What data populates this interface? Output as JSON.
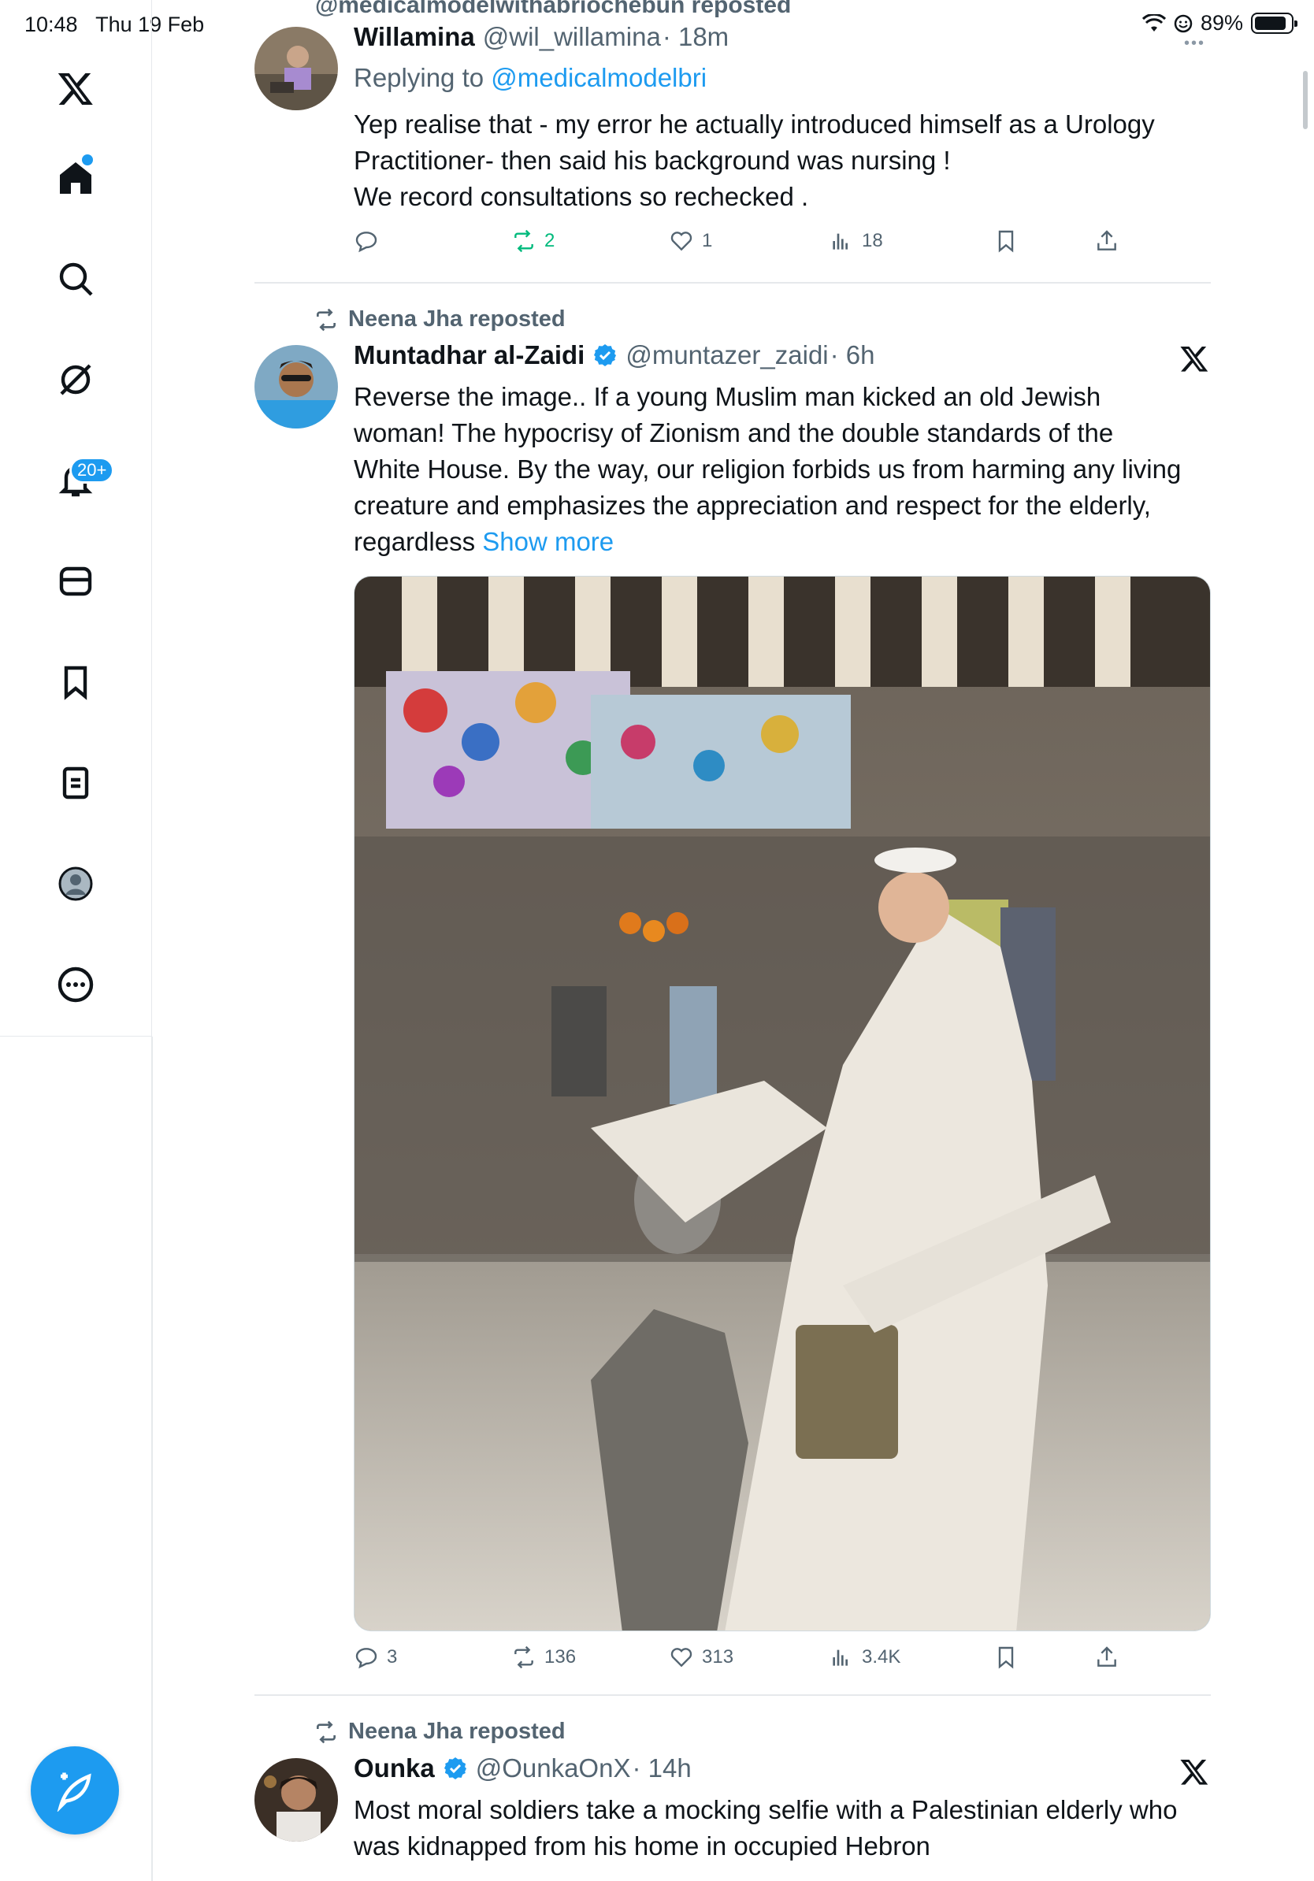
{
  "status_bar": {
    "time": "10:48",
    "date": "Thu 19 Feb",
    "battery_pct": "89%",
    "battery_level": 0.89
  },
  "sidebar": {
    "items": [
      "x-logo",
      "home",
      "search",
      "grok",
      "notifications",
      "messages",
      "bookmarks",
      "lists",
      "profile",
      "more"
    ],
    "notifications_badge": "20+"
  },
  "colors": {
    "accent": "#1d9bf0",
    "repost_green": "#00ba7c",
    "muted": "#536471"
  },
  "tweets": [
    {
      "repost_label_cut": "@medicalmodelwithabriochebun reposted",
      "name": "Willamina",
      "handle": "@wil_willamina",
      "time": "· 18m",
      "replying_label": "Replying to",
      "replying_to": "@medicalmodelbri",
      "text_lines": [
        "Yep realise that - my error he actually introduced himself as a Urology",
        "Practitioner- then said his background was nursing !",
        "We record consultations so rechecked ."
      ],
      "replies": "",
      "reposts": "2",
      "likes": "1",
      "views": "18"
    },
    {
      "repost_label": "Neena Jha reposted",
      "name": "Muntadhar al-Zaidi",
      "handle": "@muntazer_zaidi",
      "time": "· 6h",
      "text_lines": [
        "Reverse the image.. If a young Muslim man kicked an old Jewish",
        "woman! The hypocrisy of Zionism and the double standards of the",
        "White House. By the way, our religion forbids us from harming any living",
        "creature and emphasizes the appreciation and respect for the elderly,",
        "regardless"
      ],
      "show_more": "Show more",
      "replies": "3",
      "reposts": "136",
      "likes": "313",
      "views": "3.4K"
    },
    {
      "repost_label": "Neena Jha reposted",
      "name": "Ounka",
      "handle": "@OunkaOnX",
      "time": "· 14h",
      "text_lines": [
        "Most moral soldiers take a mocking selfie with a Palestinian elderly who",
        "was kidnapped from his home in occupied Hebron"
      ]
    }
  ]
}
